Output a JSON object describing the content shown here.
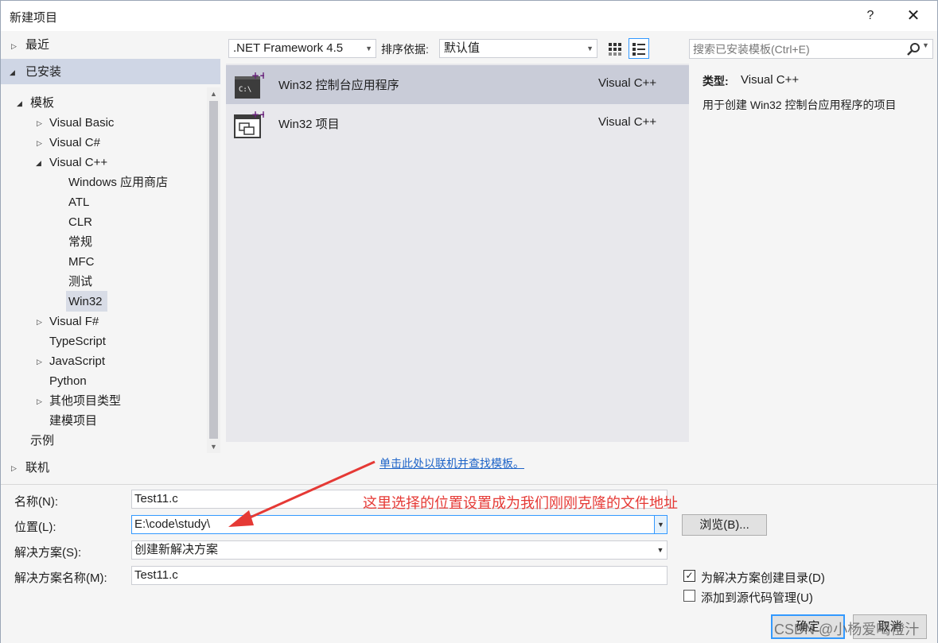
{
  "window": {
    "title": "新建项目",
    "help": "?",
    "close": "✕"
  },
  "tree": {
    "recent": "最近",
    "installed": "已安装",
    "templates": "模板",
    "visual_basic": "Visual Basic",
    "visual_csharp": "Visual C#",
    "visual_cpp": "Visual C++",
    "cpp_children": [
      "Windows 应用商店",
      "ATL",
      "CLR",
      "常规",
      "MFC",
      "测试",
      "Win32"
    ],
    "visual_fsharp": "Visual F#",
    "typescript": "TypeScript",
    "javascript": "JavaScript",
    "python": "Python",
    "other_types": "其他项目类型",
    "modeling": "建模项目",
    "samples": "示例",
    "online": "联机"
  },
  "toolbar": {
    "framework": ".NET Framework 4.5",
    "sort_label": "排序依据:",
    "sort_value": "默认值",
    "search_placeholder": "搜索已安装模板(Ctrl+E)"
  },
  "templates": [
    {
      "name": "Win32 控制台应用程序",
      "lang": "Visual C++",
      "icon": "console-app-icon"
    },
    {
      "name": "Win32 项目",
      "lang": "Visual C++",
      "icon": "win32-project-icon"
    }
  ],
  "description": {
    "type_key": "类型:",
    "type_value": "Visual C++",
    "text": "用于创建 Win32 控制台应用程序的项目"
  },
  "online_link": "单击此处以联机并查找模板。",
  "form": {
    "name_label": "名称(N):",
    "name_value": "Test11.c",
    "location_label": "位置(L):",
    "location_value": "E:\\code\\study\\",
    "browse": "浏览(B)...",
    "solution_label": "解决方案(S):",
    "solution_value": "创建新解决方案",
    "solution_name_label": "解决方案名称(M):",
    "solution_name_value": "Test11.c",
    "create_dir": "为解决方案创建目录(D)",
    "create_dir_checked": true,
    "add_source_control": "添加到源代码管理(U)",
    "add_source_control_checked": false,
    "ok": "确定",
    "cancel": "取消"
  },
  "annotation": {
    "text": "这里选择的位置设置成为我们刚刚克隆的文件地址",
    "color": "#e53935"
  },
  "watermark": "CSDN @小杨爱喝橙汁"
}
